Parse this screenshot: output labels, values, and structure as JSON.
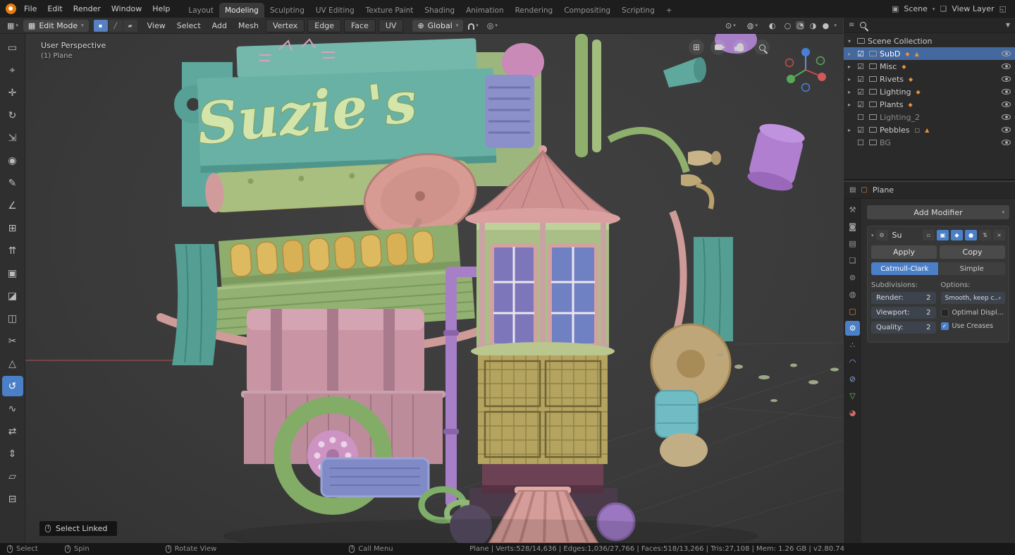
{
  "topbar": {
    "menus": [
      "File",
      "Edit",
      "Render",
      "Window",
      "Help"
    ],
    "workspaces": [
      "Layout",
      "Modeling",
      "Sculpting",
      "UV Editing",
      "Texture Paint",
      "Shading",
      "Animation",
      "Rendering",
      "Compositing",
      "Scripting"
    ],
    "add_tab": "+",
    "scene_label": "Scene",
    "view_layer_label": "View Layer"
  },
  "vheader": {
    "mode_label": "Edit Mode",
    "menus": [
      "View",
      "Select",
      "Add",
      "Mesh",
      "Vertex",
      "Edge",
      "Face",
      "UV"
    ],
    "orientation_label": "Global"
  },
  "tools": [
    {
      "n": "select-box",
      "g": "▭"
    },
    {
      "n": "cursor",
      "g": "⌖"
    },
    {
      "n": "move",
      "g": "✛"
    },
    {
      "n": "rotate",
      "g": "↻"
    },
    {
      "n": "scale",
      "g": "⇲"
    },
    {
      "n": "transform",
      "g": "◉"
    },
    {
      "n": "annotate",
      "g": "✎"
    },
    {
      "n": "measure",
      "g": "∠"
    },
    {
      "n": "add-cube",
      "g": "⊞"
    },
    {
      "n": "extrude-region",
      "g": "⇈"
    },
    {
      "n": "inset-faces",
      "g": "▣"
    },
    {
      "n": "bevel",
      "g": "◪"
    },
    {
      "n": "loop-cut",
      "g": "◫"
    },
    {
      "n": "knife",
      "g": "✂"
    },
    {
      "n": "poly-build",
      "g": "△"
    },
    {
      "n": "spin",
      "g": "↺"
    },
    {
      "n": "smooth",
      "g": "∿"
    },
    {
      "n": "edge-slide",
      "g": "⇄"
    },
    {
      "n": "shrink-fatten",
      "g": "⇕"
    },
    {
      "n": "shear",
      "g": "▱"
    },
    {
      "n": "rip-region",
      "g": "⊟"
    }
  ],
  "viewport": {
    "perspective_label": "User Perspective",
    "object_label": "(1) Plane",
    "sign_text": "Suzie's",
    "select_linked_label": "Select Linked"
  },
  "outliner": {
    "title": "Scene Collection",
    "items": [
      {
        "arrow": "▸",
        "check": "☑",
        "label": "SubD",
        "b1": "◆",
        "b2": "▲"
      },
      {
        "arrow": "▸",
        "check": "☑",
        "label": "Misc",
        "b1": "◆"
      },
      {
        "arrow": "▸",
        "check": "☑",
        "label": "Rivets",
        "b1": "◆"
      },
      {
        "arrow": "▸",
        "check": "☑",
        "label": "Lighting",
        "b1": "◆"
      },
      {
        "arrow": "▸",
        "check": "☑",
        "label": "Plants",
        "b1": "◆"
      },
      {
        "arrow": "",
        "check": "☐",
        "label": "Lighting_2"
      },
      {
        "arrow": "▸",
        "check": "☑",
        "label": "Pebbles",
        "b1": "▢",
        "b2": "▲"
      },
      {
        "arrow": "",
        "check": "☐",
        "label": "BG"
      }
    ]
  },
  "properties": {
    "object_name": "Plane",
    "add_modifier_label": "Add Modifier",
    "tabs": [
      {
        "n": "tool",
        "g": "⚒"
      },
      {
        "n": "render",
        "g": "◙"
      },
      {
        "n": "output",
        "g": "▤"
      },
      {
        "n": "view-layer",
        "g": "❏"
      },
      {
        "n": "scene",
        "g": "⊚"
      },
      {
        "n": "world",
        "g": "◍"
      },
      {
        "n": "object",
        "g": "▢"
      },
      {
        "n": "modifiers",
        "g": "⚙"
      },
      {
        "n": "particles",
        "g": "∴"
      },
      {
        "n": "physics",
        "g": "◠"
      },
      {
        "n": "constraints",
        "g": "⊘"
      },
      {
        "n": "object-data",
        "g": "▽"
      },
      {
        "n": "material",
        "g": "◕"
      }
    ],
    "modifier": {
      "name": "Su",
      "apply_label": "Apply",
      "copy_label": "Copy",
      "type_catmull": "Catmull-Clark",
      "type_simple": "Simple",
      "subdivisions_label": "Subdivisions:",
      "options_label": "Options:",
      "render_label": "Render:",
      "render_value": "2",
      "viewport_label": "Viewport:",
      "viewport_value": "2",
      "quality_label": "Quality:",
      "quality_value": "2",
      "uv_smooth_value": "Smooth, keep c..",
      "optimal_display_label": "Optimal Displ...",
      "use_creases_label": "Use Creases"
    }
  },
  "statusbar": {
    "hints": [
      {
        "label": "Select"
      },
      {
        "label": "Spin"
      },
      {
        "label": "Rotate View"
      },
      {
        "label": "Call Menu"
      }
    ],
    "stats": "Plane | Verts:528/14,636 | Edges:1,036/27,766 | Faces:518/13,266 | Tris:27,108 | Mem: 1.26 GB | v2.80.74"
  },
  "icons": {
    "caret": "▾",
    "expand": "▸",
    "editor": "▦",
    "orientation": "⊕",
    "proportional": "◎",
    "pivot": "⊙",
    "overlays": "◍",
    "xray": "◐",
    "shade_wire": "○",
    "shade_solid": "◔",
    "shade_material": "◑",
    "shade_render": "●",
    "grid": "⊞",
    "scene": "▣",
    "view_layer": "❏",
    "screens": "◱",
    "outliner_editor": "≡",
    "filter": "▼",
    "props_editor": "▤",
    "object": "▢",
    "close": "×",
    "check": "✓",
    "vertex_mode": "▪",
    "edge_mode": "╱",
    "face_mode": "▰",
    "wrench": "⚙",
    "updown": "⇅",
    "mod_toggle_cage": "▫",
    "mod_toggle_edit": "▣",
    "mod_toggle_view": "◆",
    "mod_toggle_render": "●"
  }
}
